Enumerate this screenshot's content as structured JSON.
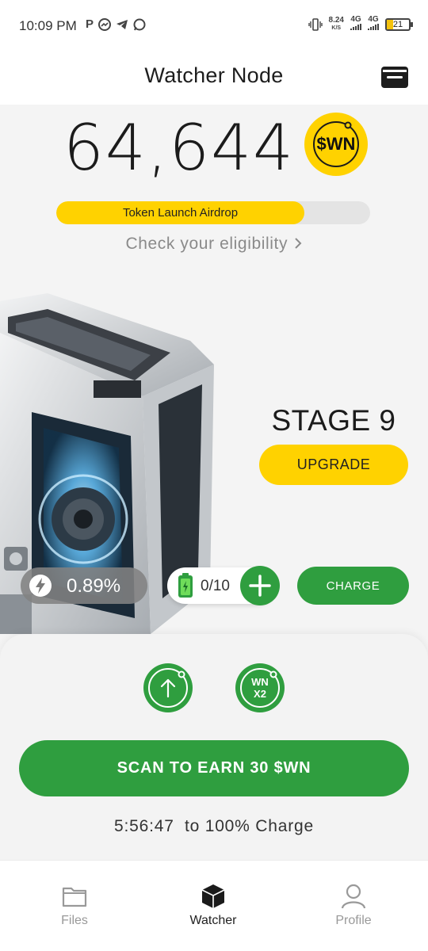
{
  "status_bar": {
    "time": "10:09 PM",
    "app_icons": [
      "P",
      "messenger-icon",
      "telegram-icon",
      "whatsapp-icon"
    ],
    "net_speed": "8.24",
    "net_speed_unit": "K/S",
    "network_1": "4G",
    "network_2": "4G",
    "battery": "21"
  },
  "header": {
    "title": "Watcher Node",
    "wallet_icon": "wallet-icon"
  },
  "balance": {
    "amount": "64,644",
    "token": "$WN"
  },
  "airdrop": {
    "label": "Token Launch Airdrop",
    "progress_fraction": 0.79,
    "link_text": "Check your eligibility",
    "link_icon": "chevron-right-icon"
  },
  "node": {
    "stage": "STAGE 9",
    "upgrade_label": "UPGRADE"
  },
  "stats": {
    "rate": "0.89%",
    "energy": "0/10",
    "charge_label": "CHARGE"
  },
  "boosts": {
    "x2_line1": "WN",
    "x2_line2": "X2"
  },
  "actions": {
    "scan_label": "SCAN TO EARN 30 $WN",
    "timer": "5:56:47  to 100% Charge"
  },
  "nav": {
    "items": [
      {
        "label": "Files",
        "icon": "folder-icon"
      },
      {
        "label": "Watcher",
        "icon": "cube-icon"
      },
      {
        "label": "Profile",
        "icon": "user-icon"
      }
    ],
    "active": "Watcher"
  },
  "colors": {
    "accent_yellow": "#ffd200",
    "accent_green": "#2f9e3f",
    "background": "#f4f4f4"
  }
}
